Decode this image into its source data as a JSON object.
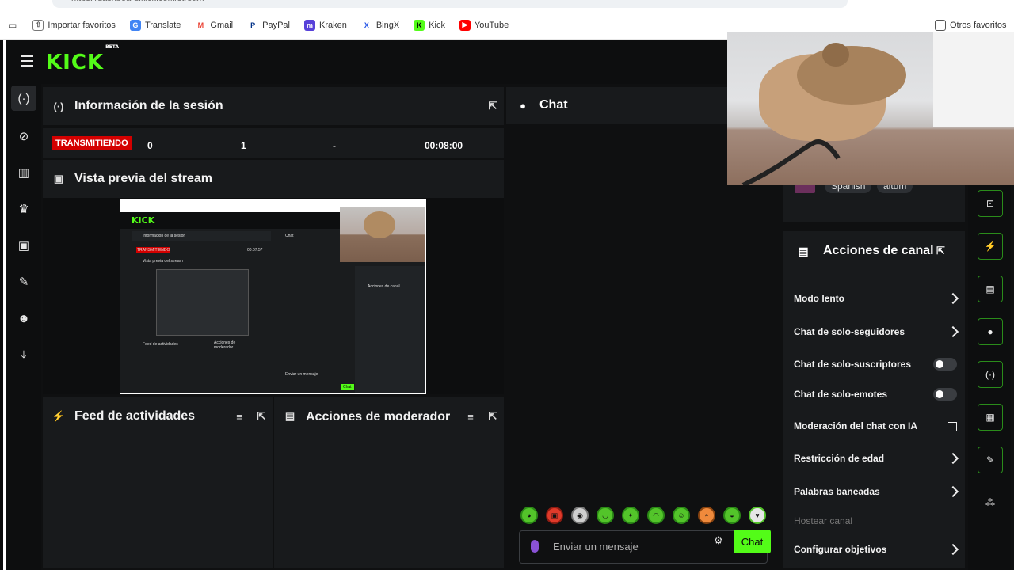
{
  "browser": {
    "url": "https://dashboard.kick.com/stream",
    "bookmarks": [
      {
        "label": "Importar favoritos",
        "icon": "import-icon",
        "color": "#666666"
      },
      {
        "label": "Translate",
        "icon": "translate-icon",
        "color": "#4285f4"
      },
      {
        "label": "Gmail",
        "icon": "gmail-icon",
        "color": "#ea4335"
      },
      {
        "label": "PayPal",
        "icon": "paypal-icon",
        "color": "#003087"
      },
      {
        "label": "Kraken",
        "icon": "kraken-icon",
        "color": "#5741d9"
      },
      {
        "label": "BingX",
        "icon": "bingx-icon",
        "color": "#2354e6"
      },
      {
        "label": "Kick",
        "icon": "kick-icon",
        "color": "#53fc18"
      },
      {
        "label": "YouTube",
        "icon": "youtube-icon",
        "color": "#ff0000"
      }
    ],
    "other_bookmarks": "Otros favoritos"
  },
  "app": {
    "logo": "KICK",
    "logo_beta": "BETA",
    "accent": "#53fc18"
  },
  "session": {
    "title": "Información de la sesión",
    "badge": "TRANSMITIENDO",
    "values": [
      "0",
      "1",
      "-",
      "00:08:00"
    ]
  },
  "preview": {
    "title": "Vista previa del stream",
    "mini": {
      "session": "Información de la sesión",
      "chat": "Chat",
      "preview": "Vista previa del stream",
      "live": "TRANSMITIENDO",
      "time": "00:07:57",
      "feed": "Feed de actividades",
      "mod": "Acciones de moderador",
      "channel": "Acciones de canal",
      "input": "Enviar un mensaje",
      "chat_btn": "Chat"
    }
  },
  "feed": {
    "title": "Feed de actividades"
  },
  "moderator": {
    "title": "Acciones de moderador"
  },
  "chat": {
    "title": "Chat",
    "placeholder": "Enviar un mensaje",
    "send": "Chat"
  },
  "tags": [
    "Spanish",
    "altum"
  ],
  "channel_actions": {
    "title": "Acciones de canal",
    "items": [
      {
        "label": "Modo lento",
        "control": "chevron"
      },
      {
        "label": "Chat de solo-seguidores",
        "control": "chevron"
      },
      {
        "label": "Chat de solo-suscriptores",
        "control": "toggle"
      },
      {
        "label": "Chat de solo-emotes",
        "control": "toggle"
      },
      {
        "label": "Moderación del chat con IA",
        "control": "external"
      },
      {
        "label": "Restricción de edad",
        "control": "chevron"
      },
      {
        "label": "Palabras baneadas",
        "control": "chevron"
      },
      {
        "label": "Hostear canal",
        "control": "none"
      },
      {
        "label": "Configurar objetivos",
        "control": "chevron"
      }
    ]
  }
}
